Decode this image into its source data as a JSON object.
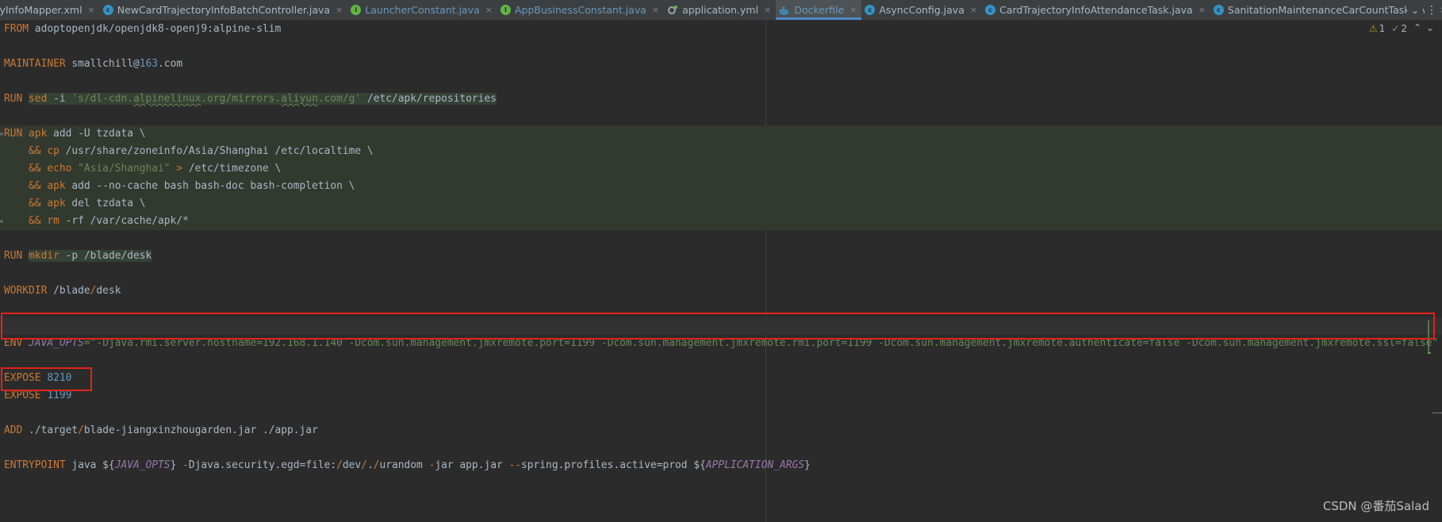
{
  "tabs": [
    {
      "label": "lyInfoMapper.xml",
      "icon": "xml-file-icon",
      "kind": "xml",
      "vcs": "normal",
      "active": false
    },
    {
      "label": "NewCardTrajectoryInfoBatchController.java",
      "icon": "java-class-icon",
      "kind": "java",
      "vcs": "normal",
      "active": false
    },
    {
      "label": "LauncherConstant.java",
      "icon": "java-interface-icon",
      "kind": "iface",
      "vcs": "modified",
      "active": false
    },
    {
      "label": "AppBusinessConstant.java",
      "icon": "java-interface-icon",
      "kind": "iface",
      "vcs": "modified",
      "active": false
    },
    {
      "label": "application.yml",
      "icon": "yaml-file-icon",
      "kind": "yml",
      "vcs": "normal",
      "active": false
    },
    {
      "label": "Dockerfile",
      "icon": "docker-file-icon",
      "kind": "docker",
      "vcs": "modified",
      "active": true
    },
    {
      "label": "AsyncConfig.java",
      "icon": "java-class-icon",
      "kind": "java",
      "vcs": "normal",
      "active": false
    },
    {
      "label": "CardTrajectoryInfoAttendanceTask.java",
      "icon": "java-class-icon",
      "kind": "java",
      "vcs": "normal",
      "active": false
    },
    {
      "label": "SanitationMaintenanceCarCountTask.java",
      "icon": "java-class-icon",
      "kind": "java",
      "vcs": "normal",
      "active": false
    }
  ],
  "inspections": {
    "warnings": "1",
    "weak_warnings": "2"
  },
  "watermark": "CSDN @番茄Salad",
  "code_lines": [
    {
      "segs": [
        {
          "t": "FROM",
          "c": "kw"
        },
        {
          "t": " adoptopenjdk/openjdk8-openj9:alpine-slim",
          "c": ""
        }
      ]
    },
    {
      "segs": []
    },
    {
      "segs": [
        {
          "t": "MAINTAINER",
          "c": "kw"
        },
        {
          "t": " smallchill@",
          "c": ""
        },
        {
          "t": "163",
          "c": "num"
        },
        {
          "t": ".com",
          "c": ""
        }
      ]
    },
    {
      "segs": []
    },
    {
      "segs": [
        {
          "t": "RUN ",
          "c": "kw"
        },
        {
          "t": "sed",
          "c": "kw",
          "hl": true
        },
        {
          "t": " -i ",
          "c": "",
          "hl": true
        },
        {
          "t": "'s/dl-cdn.",
          "c": "str",
          "hl": true
        },
        {
          "t": "alpinelinux",
          "c": "str typo",
          "hl": true
        },
        {
          "t": ".org/mirrors.",
          "c": "str",
          "hl": true
        },
        {
          "t": "aliyun",
          "c": "str typo",
          "hl": true
        },
        {
          "t": ".com/g'",
          "c": "str",
          "hl": true
        },
        {
          "t": " /etc/apk/repositories",
          "c": "",
          "hl": true
        }
      ]
    },
    {
      "segs": []
    },
    {
      "block": true,
      "mark": true,
      "segs": [
        {
          "t": "RUN ",
          "c": "kw"
        },
        {
          "t": "apk",
          "c": "kw"
        },
        {
          "t": " add -U tzdata \\",
          "c": ""
        }
      ]
    },
    {
      "block": true,
      "segs": [
        {
          "t": "    && ",
          "c": "kw"
        },
        {
          "t": "cp",
          "c": "kw"
        },
        {
          "t": " /usr/share/zoneinfo/Asia/Shanghai /etc/localtime \\",
          "c": ""
        }
      ]
    },
    {
      "block": true,
      "segs": [
        {
          "t": "    && ",
          "c": "kw"
        },
        {
          "t": "echo",
          "c": "kw"
        },
        {
          "t": " ",
          "c": ""
        },
        {
          "t": "\"Asia/Shanghai\"",
          "c": "str"
        },
        {
          "t": " > ",
          "c": "kw"
        },
        {
          "t": "/etc/timezone \\",
          "c": ""
        }
      ]
    },
    {
      "block": true,
      "segs": [
        {
          "t": "    && ",
          "c": "kw"
        },
        {
          "t": "apk",
          "c": "kw"
        },
        {
          "t": " add --no-cache bash bash-doc bash-completion \\",
          "c": ""
        }
      ]
    },
    {
      "block": true,
      "segs": [
        {
          "t": "    && ",
          "c": "kw"
        },
        {
          "t": "apk",
          "c": "kw"
        },
        {
          "t": " del tzdata \\",
          "c": ""
        }
      ]
    },
    {
      "block": true,
      "mark": true,
      "segs": [
        {
          "t": "    && ",
          "c": "kw"
        },
        {
          "t": "rm",
          "c": "kw"
        },
        {
          "t": " -rf /var/cache/apk/*",
          "c": ""
        }
      ]
    },
    {
      "segs": []
    },
    {
      "segs": [
        {
          "t": "RUN ",
          "c": "kw"
        },
        {
          "t": "mkdir",
          "c": "kw",
          "hl": true
        },
        {
          "t": " -p /blade/desk",
          "c": "",
          "hl": true
        }
      ]
    },
    {
      "segs": []
    },
    {
      "segs": [
        {
          "t": "WORKDIR",
          "c": "kw"
        },
        {
          "t": " /blade",
          "c": ""
        },
        {
          "t": "/",
          "c": "kw"
        },
        {
          "t": "desk",
          "c": ""
        }
      ]
    },
    {
      "segs": []
    },
    {
      "cur": true,
      "segs": []
    },
    {
      "segs": [
        {
          "t": "ENV ",
          "c": "kw"
        },
        {
          "t": "JAVA_OPTS",
          "c": "var"
        },
        {
          "t": "=\"-Djava.rmi.server.hostname=192.168.1.140 -Dcom.sun.management.jmxremote.port=1199 -Dcom.sun.management.jmxremote.rmi.port=1199 -Dcom.sun.management.jmxremote.authenticate=false -Dcom.sun.management.jmxremote.ssl=false\"",
          "c": "str"
        }
      ]
    },
    {
      "segs": []
    },
    {
      "segs": [
        {
          "t": "EXPOSE",
          "c": "kw"
        },
        {
          "t": " ",
          "c": ""
        },
        {
          "t": "8210",
          "c": "num"
        }
      ]
    },
    {
      "segs": [
        {
          "t": "EXPOSE",
          "c": "kw"
        },
        {
          "t": " ",
          "c": ""
        },
        {
          "t": "1199",
          "c": "num"
        }
      ]
    },
    {
      "segs": []
    },
    {
      "segs": [
        {
          "t": "ADD",
          "c": "kw"
        },
        {
          "t": " ./target",
          "c": ""
        },
        {
          "t": "/",
          "c": "kw"
        },
        {
          "t": "blade-jiangxinzhougarden.jar ./app.jar",
          "c": ""
        }
      ]
    },
    {
      "segs": []
    },
    {
      "segs": [
        {
          "t": "ENTRYPOINT",
          "c": "kw"
        },
        {
          "t": " java ${",
          "c": ""
        },
        {
          "t": "JAVA_OPTS",
          "c": "var"
        },
        {
          "t": "} ",
          "c": ""
        },
        {
          "t": "-",
          "c": "kw"
        },
        {
          "t": "Djava.security.egd=file:",
          "c": ""
        },
        {
          "t": "/",
          "c": "kw"
        },
        {
          "t": "dev",
          "c": ""
        },
        {
          "t": "/",
          "c": "kw"
        },
        {
          "t": ".",
          "c": ""
        },
        {
          "t": "/",
          "c": "kw"
        },
        {
          "t": "urandom ",
          "c": ""
        },
        {
          "t": "-",
          "c": "kw"
        },
        {
          "t": "jar app.jar ",
          "c": ""
        },
        {
          "t": "--",
          "c": "kw"
        },
        {
          "t": "spring.profiles.active=prod ${",
          "c": ""
        },
        {
          "t": "APPLICATION_ARGS",
          "c": "var"
        },
        {
          "t": "}",
          "c": ""
        }
      ]
    }
  ]
}
